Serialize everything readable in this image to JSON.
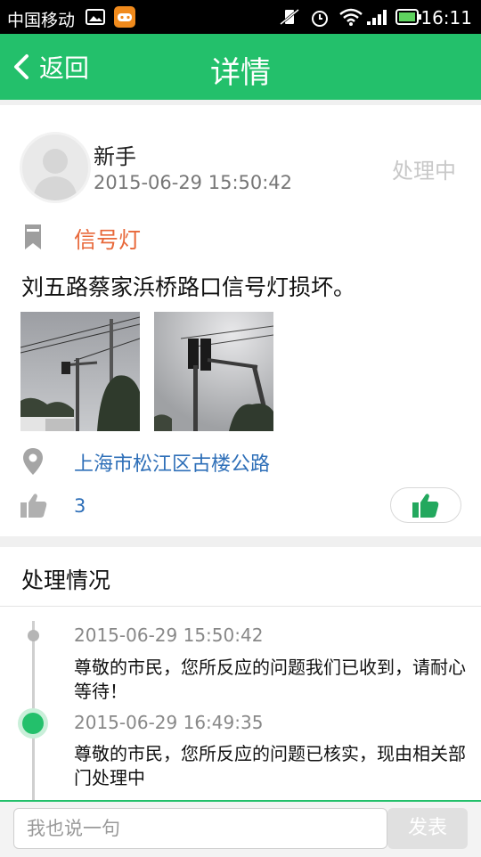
{
  "status_bar": {
    "carrier": "中国移动",
    "time": "16:11"
  },
  "header": {
    "back_label": "返回",
    "title": "详情"
  },
  "post": {
    "username": "新手",
    "time": "2015-06-29 15:50:42",
    "status": "处理中",
    "category": "信号灯",
    "description": "刘五路蔡家浜桥路口信号灯损坏。",
    "location": "上海市松江区古楼公路",
    "like_count": "3"
  },
  "processing": {
    "section_title": "处理情况",
    "entries": [
      {
        "time": "2015-06-29 15:50:42",
        "text": "尊敬的市民，您所反应的问题我们已收到，请耐心等待！"
      },
      {
        "time": "2015-06-29 16:49:35",
        "text": "尊敬的市民，您所反应的问题已核实，现由相关部门处理中"
      }
    ]
  },
  "comment_bar": {
    "placeholder": "我也说一句",
    "publish_label": "发表"
  },
  "colors": {
    "brand_green": "#23c06b",
    "category_orange": "#e8683a",
    "link_blue": "#2e6fb8",
    "status_gray": "#c8c8c8"
  },
  "icons": [
    "back-icon",
    "bookmark-icon",
    "location-pin-icon",
    "thumbs-up-icon"
  ]
}
